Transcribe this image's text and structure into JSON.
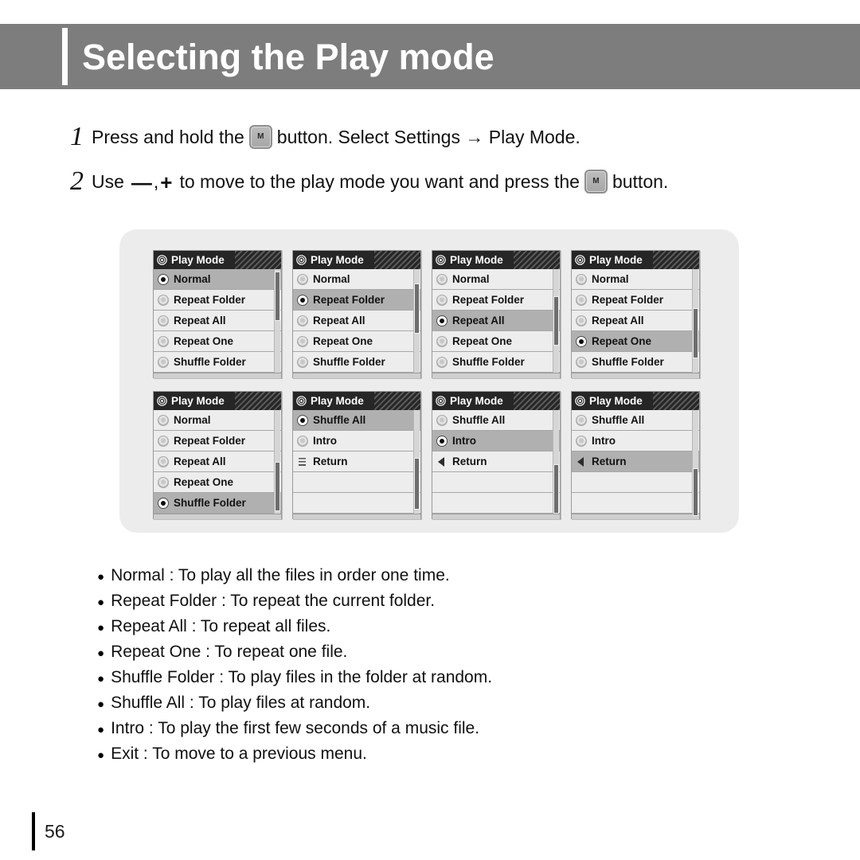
{
  "header": {
    "title": "Selecting the Play mode"
  },
  "steps": [
    {
      "number": "1",
      "text_before": "Press and hold the",
      "button_icon": "m-button",
      "button_label": "M",
      "text_after": "button. Select Settings → Play Mode."
    },
    {
      "number": "2",
      "text_before": "Use",
      "minus_glyph": "—",
      "comma": ",",
      "plus_glyph": "+",
      "text_mid": "to move to the play mode you want and press the",
      "button_icon": "m-button",
      "button_label": "M",
      "text_after": "button."
    }
  ],
  "screens": [
    {
      "title": "Play Mode",
      "title_icon": "gear-icon",
      "scroll_thumb_top_pct": 2,
      "scroll_thumb_height_pct": 48,
      "rows": [
        {
          "label": "Normal",
          "icon": "radio",
          "selected": true
        },
        {
          "label": "Repeat Folder",
          "icon": "radio",
          "selected": false
        },
        {
          "label": "Repeat All",
          "icon": "radio",
          "selected": false
        },
        {
          "label": "Repeat One",
          "icon": "radio",
          "selected": false
        },
        {
          "label": "Shuffle Folder",
          "icon": "radio",
          "selected": false
        }
      ]
    },
    {
      "title": "Play Mode",
      "title_icon": "gear-icon",
      "scroll_thumb_top_pct": 14,
      "scroll_thumb_height_pct": 48,
      "rows": [
        {
          "label": "Normal",
          "icon": "radio",
          "selected": false
        },
        {
          "label": "Repeat Folder",
          "icon": "radio",
          "selected": true
        },
        {
          "label": "Repeat All",
          "icon": "radio",
          "selected": false
        },
        {
          "label": "Repeat One",
          "icon": "radio",
          "selected": false
        },
        {
          "label": "Shuffle Folder",
          "icon": "radio",
          "selected": false
        }
      ]
    },
    {
      "title": "Play Mode",
      "title_icon": "gear-icon",
      "scroll_thumb_top_pct": 26,
      "scroll_thumb_height_pct": 48,
      "rows": [
        {
          "label": "Normal",
          "icon": "radio",
          "selected": false
        },
        {
          "label": "Repeat Folder",
          "icon": "radio",
          "selected": false
        },
        {
          "label": "Repeat All",
          "icon": "radio",
          "selected": true
        },
        {
          "label": "Repeat One",
          "icon": "radio",
          "selected": false
        },
        {
          "label": "Shuffle Folder",
          "icon": "radio",
          "selected": false
        }
      ]
    },
    {
      "title": "Play Mode",
      "title_icon": "gear-icon",
      "scroll_thumb_top_pct": 38,
      "scroll_thumb_height_pct": 48,
      "rows": [
        {
          "label": "Normal",
          "icon": "radio",
          "selected": false
        },
        {
          "label": "Repeat Folder",
          "icon": "radio",
          "selected": false
        },
        {
          "label": "Repeat All",
          "icon": "radio",
          "selected": false
        },
        {
          "label": "Repeat One",
          "icon": "radio",
          "selected": true
        },
        {
          "label": "Shuffle Folder",
          "icon": "radio",
          "selected": false
        }
      ]
    },
    {
      "title": "Play Mode",
      "title_icon": "gear-icon",
      "scroll_thumb_top_pct": 50,
      "scroll_thumb_height_pct": 48,
      "rows": [
        {
          "label": "Normal",
          "icon": "radio",
          "selected": false
        },
        {
          "label": "Repeat Folder",
          "icon": "radio",
          "selected": false
        },
        {
          "label": "Repeat All",
          "icon": "radio",
          "selected": false
        },
        {
          "label": "Repeat One",
          "icon": "radio",
          "selected": false
        },
        {
          "label": "Shuffle Folder",
          "icon": "radio",
          "selected": true
        }
      ]
    },
    {
      "title": "Play Mode",
      "title_icon": "gear-icon",
      "scroll_thumb_top_pct": 46,
      "scroll_thumb_height_pct": 50,
      "rows": [
        {
          "label": "Shuffle All",
          "icon": "radio",
          "selected": true
        },
        {
          "label": "Intro",
          "icon": "radio",
          "selected": false
        },
        {
          "label": "Return",
          "icon": "return-lines",
          "selected": false
        },
        {
          "label": "",
          "icon": "none",
          "selected": false
        },
        {
          "label": "",
          "icon": "none",
          "selected": false
        }
      ]
    },
    {
      "title": "Play Mode",
      "title_icon": "gear-icon",
      "scroll_thumb_top_pct": 52,
      "scroll_thumb_height_pct": 48,
      "rows": [
        {
          "label": "Shuffle All",
          "icon": "radio",
          "selected": false
        },
        {
          "label": "Intro",
          "icon": "radio",
          "selected": true
        },
        {
          "label": "Return",
          "icon": "return-arrow",
          "selected": false
        },
        {
          "label": "",
          "icon": "none",
          "selected": false
        },
        {
          "label": "",
          "icon": "none",
          "selected": false
        }
      ]
    },
    {
      "title": "Play Mode",
      "title_icon": "gear-icon",
      "scroll_thumb_top_pct": 56,
      "scroll_thumb_height_pct": 46,
      "rows": [
        {
          "label": "Shuffle All",
          "icon": "radio",
          "selected": false
        },
        {
          "label": "Intro",
          "icon": "radio",
          "selected": false
        },
        {
          "label": "Return",
          "icon": "return-arrow",
          "selected": true
        },
        {
          "label": "",
          "icon": "none",
          "selected": false
        },
        {
          "label": "",
          "icon": "none",
          "selected": false
        }
      ]
    }
  ],
  "descriptions": [
    {
      "bullet": "●",
      "text": "Normal : To play all the files in order one time."
    },
    {
      "bullet": "●",
      "text": "Repeat Folder : To repeat the current folder."
    },
    {
      "bullet": "●",
      "text": "Repeat All : To repeat all files."
    },
    {
      "bullet": "●",
      "text": "Repeat One : To repeat one file."
    },
    {
      "bullet": "●",
      "text": "Shuffle Folder : To play files in the folder at random."
    },
    {
      "bullet": "●",
      "text": "Shuffle All : To play files at random."
    },
    {
      "bullet": "●",
      "text": "Intro : To play the first few seconds of a music file."
    },
    {
      "bullet": "●",
      "text": "Exit : To move to a previous menu."
    }
  ],
  "footer": {
    "page_number": "56"
  },
  "colors": {
    "header_band": "#7d7d7d",
    "panel_bg": "#ececec",
    "lcd_titlebar": "#262626",
    "lcd_row": "#ededed",
    "lcd_row_selected": "#b0b0b0",
    "page_bg": "#ffffff"
  }
}
